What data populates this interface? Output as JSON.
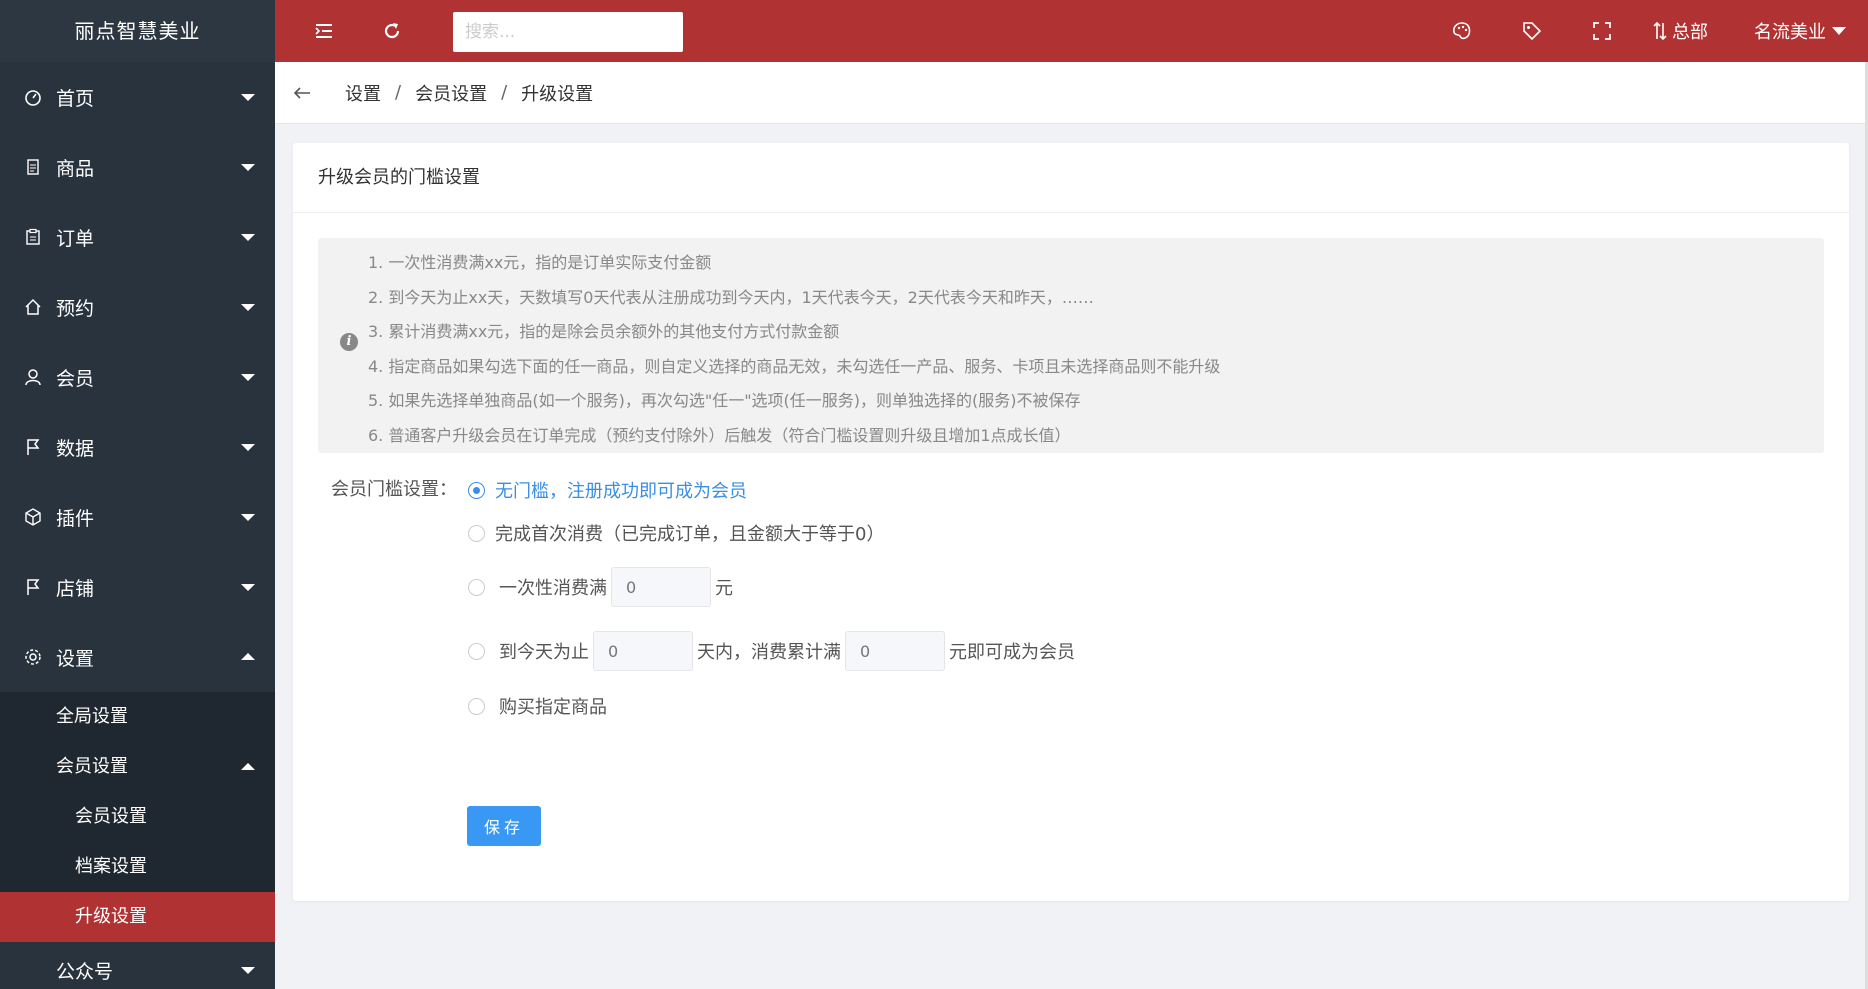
{
  "brand": "丽点智慧美业",
  "topbar": {
    "search_placeholder": "搜索...",
    "hq_label": "总部",
    "shop_label": "名流美业"
  },
  "sidebar": {
    "items": [
      {
        "label": "首页",
        "icon": "dashboard-icon"
      },
      {
        "label": "商品",
        "icon": "document-icon"
      },
      {
        "label": "订单",
        "icon": "clipboard-icon"
      },
      {
        "label": "预约",
        "icon": "home-icon"
      },
      {
        "label": "会员",
        "icon": "user-icon"
      },
      {
        "label": "数据",
        "icon": "flag-icon"
      },
      {
        "label": "插件",
        "icon": "cube-icon"
      },
      {
        "label": "店铺",
        "icon": "flag-icon"
      },
      {
        "label": "设置",
        "icon": "gear-icon"
      }
    ],
    "settings_sub": {
      "global": "全局设置",
      "member": "会员设置",
      "member_sub": [
        "会员设置",
        "档案设置",
        "升级设置"
      ]
    },
    "next_item": "公众号"
  },
  "breadcrumb": [
    "设置",
    "会员设置",
    "升级设置"
  ],
  "panel": {
    "title": "升级会员的门槛设置",
    "notes": [
      "1. 一次性消费满xx元，指的是订单实际支付金额",
      "2. 到今天为止xx天，天数填写0天代表从注册成功到今天内，1天代表今天，2天代表今天和昨天，……",
      "3. 累计消费满xx元，指的是除会员余额外的其他支付方式付款金额",
      "4. 指定商品如果勾选下面的任一商品，则自定义选择的商品无效，未勾选任一产品、服务、卡项且未选择商品则不能升级",
      "5. 如果先选择单独商品(如一个服务)，再次勾选\"任一\"选项(任一服务)，则单独选择的(服务)不被保存",
      "6. 普通客户升级会员在订单完成（预约支付除外）后触发（符合门槛设置则升级且增加1点成长值）"
    ],
    "form_label": "会员门槛设置：",
    "options": {
      "none": "无门槛，注册成功即可成为会员",
      "first": "完成首次消费（已完成订单，且金额大于等于0）",
      "once_prefix": "一次性消费满",
      "once_value": "0",
      "once_suffix": "元",
      "cumulative_prefix": "到今天为止",
      "days_value": "0",
      "cumulative_mid": "天内，消费累计满",
      "amount_value": "0",
      "cumulative_suffix": "元即可成为会员",
      "product": "购买指定商品"
    },
    "save_label": "保存"
  },
  "colors": {
    "accent": "#b03232",
    "sidebar": "#28333e",
    "primary": "#3a98f5"
  }
}
